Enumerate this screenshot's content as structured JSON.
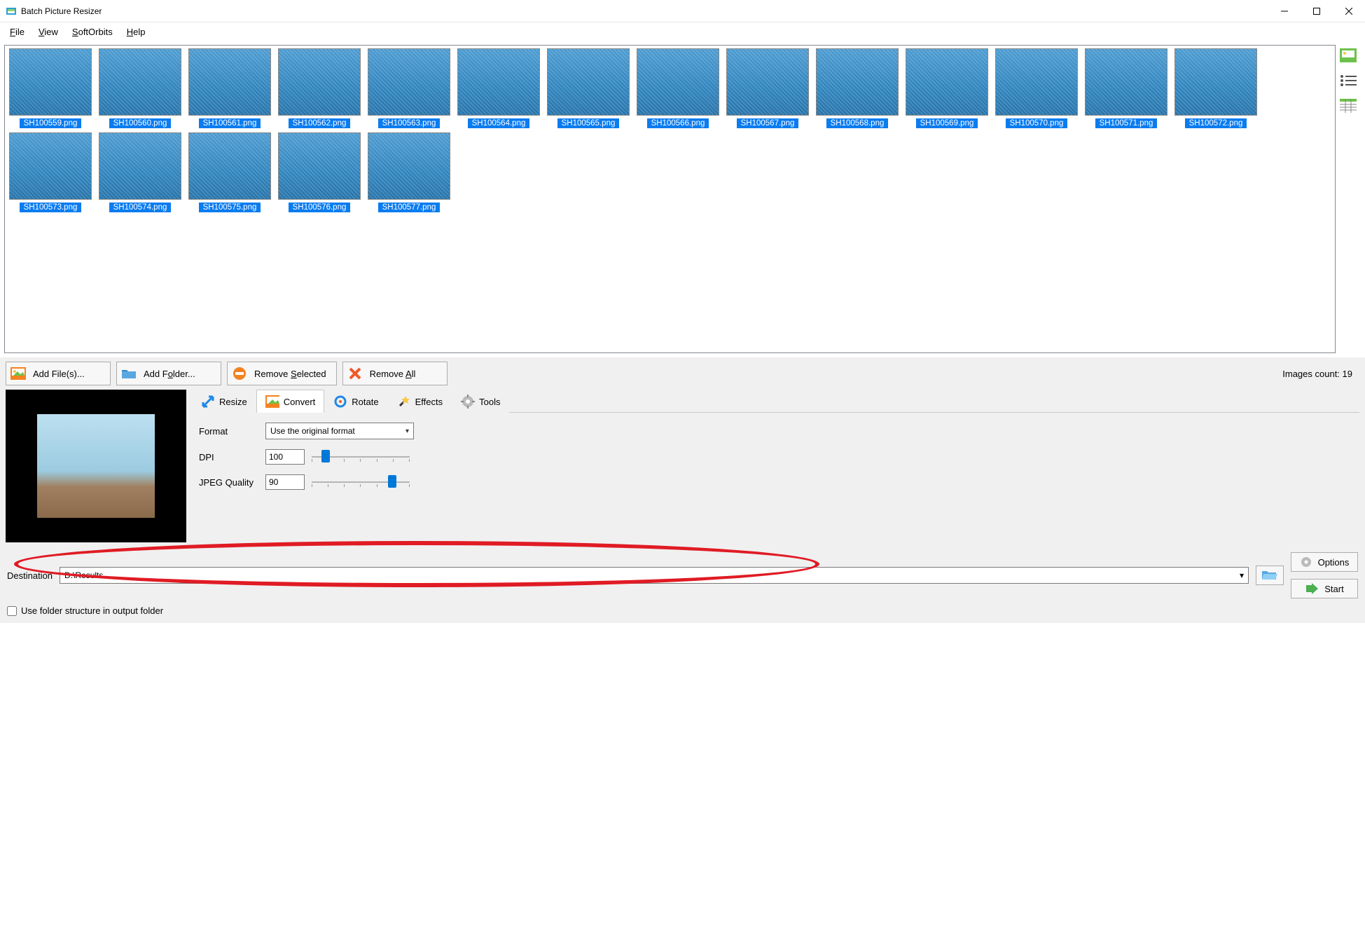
{
  "window": {
    "title": "Batch Picture Resizer"
  },
  "menu": {
    "file": "File",
    "view": "View",
    "softorbits": "SoftOrbits",
    "help": "Help"
  },
  "thumbnails": [
    "SH100559.png",
    "SH100560.png",
    "SH100561.png",
    "SH100562.png",
    "SH100563.png",
    "SH100564.png",
    "SH100565.png",
    "SH100566.png",
    "SH100567.png",
    "SH100568.png",
    "SH100569.png",
    "SH100570.png",
    "SH100571.png",
    "SH100572.png",
    "SH100573.png",
    "SH100574.png",
    "SH100575.png",
    "SH100576.png",
    "SH100577.png"
  ],
  "actions": {
    "add_files": "Add File(s)...",
    "add_folder": "Add Folder...",
    "remove_selected": "Remove Selected",
    "remove_all": "Remove All",
    "images_count_label": "Images count: 19"
  },
  "tabs": {
    "resize": "Resize",
    "convert": "Convert",
    "rotate": "Rotate",
    "effects": "Effects",
    "tools": "Tools"
  },
  "convert": {
    "format_label": "Format",
    "format_value": "Use the original format",
    "dpi_label": "DPI",
    "dpi_value": "100",
    "jpeg_label": "JPEG Quality",
    "jpeg_value": "90"
  },
  "destination": {
    "label": "Destination",
    "value": "D:\\Results",
    "use_folder_structure": "Use folder structure in output folder",
    "options": "Options",
    "start": "Start"
  }
}
